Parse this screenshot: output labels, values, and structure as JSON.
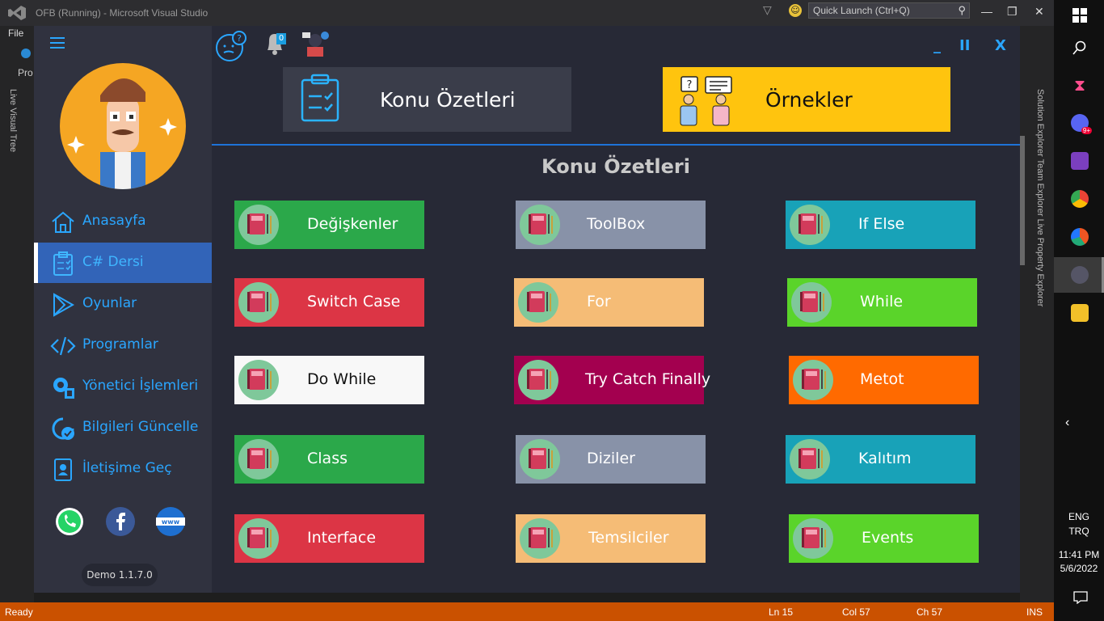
{
  "vs": {
    "title": "OFB (Running) - Microsoft Visual Studio",
    "quick_launch": "Quick Launch (Ctrl+Q)",
    "menu_file": "File",
    "left_label": "Pro",
    "left_panel": "Live Visual Tree",
    "right_panels": "Solution Explorer   Team Explorer   Live Property Explorer",
    "status": {
      "ready": "Ready",
      "ln": "Ln 15",
      "col": "Col 57",
      "ch": "Ch 57",
      "ins": "INS"
    }
  },
  "taskbar": {
    "lang": "ENG",
    "layout": "TRQ",
    "time": "11:41 PM",
    "date": "5/6/2022",
    "discord_badge": "9+"
  },
  "app": {
    "notification_count": "0",
    "window_controls": {
      "minimize": "_",
      "pause": "II",
      "close": "X"
    },
    "nav": [
      {
        "label": "Anasayfa",
        "icon": "home-icon"
      },
      {
        "label": "C# Dersi",
        "icon": "clipboard-icon",
        "active": true
      },
      {
        "label": "Oyunlar",
        "icon": "play-icon"
      },
      {
        "label": "Programlar",
        "icon": "code-icon"
      },
      {
        "label": "Yönetici İşlemleri",
        "icon": "settings-icon"
      },
      {
        "label": "Bilgileri Güncelle",
        "icon": "refresh-check-icon"
      },
      {
        "label": "İletişime Geç",
        "icon": "contact-icon"
      }
    ],
    "version": "Demo 1.1.7.0",
    "tabs": {
      "summaries": "Konu Özetleri",
      "examples": "Örnekler"
    },
    "section_title": "Konu Özetleri",
    "cards": [
      {
        "label": "Değişkenler",
        "color": "#2ba84a"
      },
      {
        "label": "ToolBox",
        "color": "#8892a8"
      },
      {
        "label": "If Else",
        "color": "#18a2b8"
      },
      {
        "label": "Switch Case",
        "color": "#dc3545"
      },
      {
        "label": "For",
        "color": "#f5bc76"
      },
      {
        "label": "While",
        "color": "#5ad42a"
      },
      {
        "label": "Do While",
        "color": "#f8f8f8"
      },
      {
        "label": "Try Catch Finally",
        "color": "#a3004f"
      },
      {
        "label": "Metot",
        "color": "#ff6a00"
      },
      {
        "label": "Class",
        "color": "#2ba84a"
      },
      {
        "label": "Diziler",
        "color": "#8892a8"
      },
      {
        "label": "Kalıtım",
        "color": "#18a2b8"
      },
      {
        "label": "Interface",
        "color": "#dc3545"
      },
      {
        "label": "Temsilciler",
        "color": "#f5bc76"
      },
      {
        "label": "Events",
        "color": "#5ad42a"
      }
    ]
  }
}
